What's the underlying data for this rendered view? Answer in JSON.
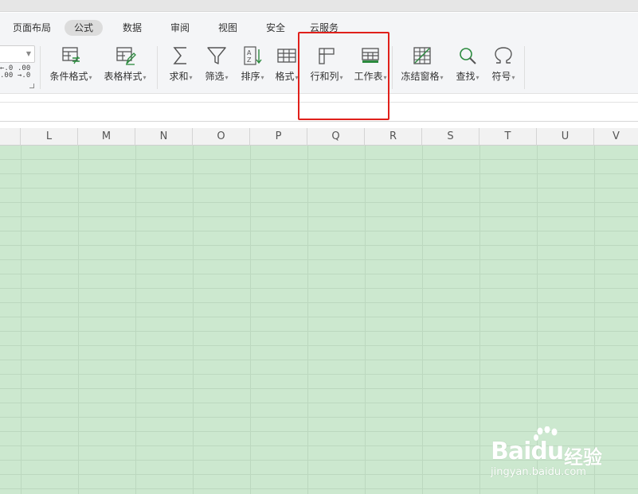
{
  "menu": {
    "tabs": [
      {
        "label": "页面布局"
      },
      {
        "label": "公式"
      },
      {
        "label": "数据"
      },
      {
        "label": "审阅"
      },
      {
        "label": "视图"
      },
      {
        "label": "安全"
      },
      {
        "label": "云服务"
      }
    ],
    "active": "公式"
  },
  "ribbon": {
    "number_format": {
      "increase_decimal": "←.0\n.00",
      "decrease_decimal": ".00\n→.0"
    },
    "buttons": [
      {
        "label": "条件格式",
        "icon": "conditional-format-icon",
        "dropdown": true
      },
      {
        "label": "表格样式",
        "icon": "table-style-icon",
        "dropdown": true
      },
      {
        "label": "求和",
        "icon": "sum-icon",
        "dropdown": true
      },
      {
        "label": "筛选",
        "icon": "filter-icon",
        "dropdown": true
      },
      {
        "label": "排序",
        "icon": "sort-icon",
        "dropdown": true
      },
      {
        "label": "格式",
        "icon": "format-icon",
        "dropdown": true
      },
      {
        "label": "行和列",
        "icon": "rows-columns-icon",
        "dropdown": true
      },
      {
        "label": "工作表",
        "icon": "worksheet-icon",
        "dropdown": true
      },
      {
        "label": "冻结窗格",
        "icon": "freeze-panes-icon",
        "dropdown": true
      },
      {
        "label": "查找",
        "icon": "find-icon",
        "dropdown": true
      },
      {
        "label": "符号",
        "icon": "symbol-icon",
        "dropdown": true
      }
    ]
  },
  "sheet": {
    "columns": [
      "L",
      "M",
      "N",
      "O",
      "P",
      "Q",
      "R",
      "S",
      "T",
      "U",
      "V"
    ],
    "colors": {
      "cell_background": "#cce8cf",
      "grid_line": "#bcd8bf",
      "highlight": "#e0201b"
    }
  },
  "watermark": {
    "brand_bai": "Bai",
    "brand_du": "du",
    "suffix": "经验",
    "url": "jingyan.baidu.com"
  }
}
